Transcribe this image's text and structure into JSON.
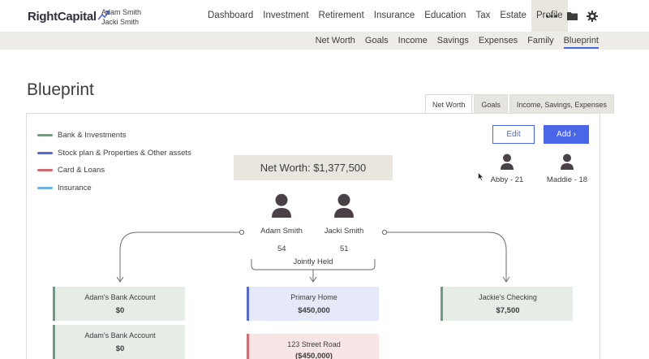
{
  "brand": {
    "name": "RightCapital",
    "accent": "#4a66e8"
  },
  "users": [
    "Adam Smith",
    "Jacki Smith"
  ],
  "main_nav": [
    {
      "label": "Dashboard",
      "active": false
    },
    {
      "label": "Investment",
      "active": false
    },
    {
      "label": "Retirement",
      "active": false
    },
    {
      "label": "Insurance",
      "active": false
    },
    {
      "label": "Education",
      "active": false
    },
    {
      "label": "Tax",
      "active": false
    },
    {
      "label": "Estate",
      "active": false
    },
    {
      "label": "Profile",
      "active": true
    }
  ],
  "nav_icons": [
    "more-icon",
    "folder-icon",
    "gear-icon"
  ],
  "sub_nav": [
    {
      "label": "Net Worth",
      "active": false
    },
    {
      "label": "Goals",
      "active": false
    },
    {
      "label": "Income",
      "active": false
    },
    {
      "label": "Savings",
      "active": false
    },
    {
      "label": "Expenses",
      "active": false
    },
    {
      "label": "Family",
      "active": false
    },
    {
      "label": "Blueprint",
      "active": true
    }
  ],
  "page_title": "Blueprint",
  "tabs": [
    {
      "label": "Net Worth",
      "active": true
    },
    {
      "label": "Goals",
      "active": false
    },
    {
      "label": "Income, Savings, Expenses",
      "active": false
    }
  ],
  "legend": [
    {
      "label": "Bank & Investments",
      "color": "#6a9e80"
    },
    {
      "label": "Stock plan & Properties & Other assets",
      "color": "#5468d6"
    },
    {
      "label": "Card & Loans",
      "color": "#d26b6b"
    },
    {
      "label": "Insurance",
      "color": "#6fb2e0"
    }
  ],
  "actions": {
    "edit": "Edit",
    "add": "Add"
  },
  "children": [
    {
      "label": "Abby - 21"
    },
    {
      "label": "Maddie - 18"
    }
  ],
  "net_worth": "Net Worth: $1,377,500",
  "clients": [
    {
      "name": "Adam Smith",
      "age": "54"
    },
    {
      "name": "Jacki Smith",
      "age": "51"
    }
  ],
  "jointly_held": "Jointly Held",
  "accounts": {
    "adam": [
      {
        "name": "Adam's Bank Account",
        "value": "$0"
      },
      {
        "name": "Adam's Bank Account",
        "value": "$0"
      }
    ],
    "joint": [
      {
        "name": "Primary Home",
        "value": "$450,000"
      },
      {
        "name": "123 Street Road",
        "value": "($450,000)"
      }
    ],
    "jacki": [
      {
        "name": "Jackie's Checking",
        "value": "$7,500"
      }
    ]
  }
}
